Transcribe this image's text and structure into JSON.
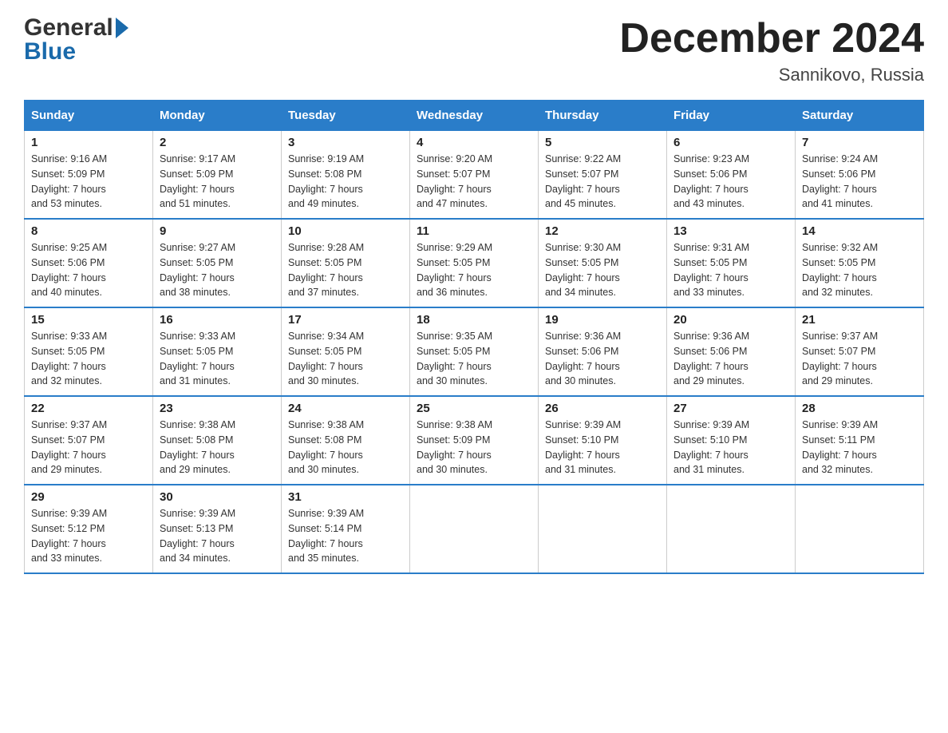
{
  "header": {
    "logo_line1": "General",
    "logo_line2": "Blue",
    "month_title": "December 2024",
    "location": "Sannikovo, Russia"
  },
  "days_of_week": [
    "Sunday",
    "Monday",
    "Tuesday",
    "Wednesday",
    "Thursday",
    "Friday",
    "Saturday"
  ],
  "weeks": [
    [
      {
        "day": "1",
        "sunrise": "9:16 AM",
        "sunset": "5:09 PM",
        "daylight_hours": "7",
        "daylight_mins": "53"
      },
      {
        "day": "2",
        "sunrise": "9:17 AM",
        "sunset": "5:09 PM",
        "daylight_hours": "7",
        "daylight_mins": "51"
      },
      {
        "day": "3",
        "sunrise": "9:19 AM",
        "sunset": "5:08 PM",
        "daylight_hours": "7",
        "daylight_mins": "49"
      },
      {
        "day": "4",
        "sunrise": "9:20 AM",
        "sunset": "5:07 PM",
        "daylight_hours": "7",
        "daylight_mins": "47"
      },
      {
        "day": "5",
        "sunrise": "9:22 AM",
        "sunset": "5:07 PM",
        "daylight_hours": "7",
        "daylight_mins": "45"
      },
      {
        "day": "6",
        "sunrise": "9:23 AM",
        "sunset": "5:06 PM",
        "daylight_hours": "7",
        "daylight_mins": "43"
      },
      {
        "day": "7",
        "sunrise": "9:24 AM",
        "sunset": "5:06 PM",
        "daylight_hours": "7",
        "daylight_mins": "41"
      }
    ],
    [
      {
        "day": "8",
        "sunrise": "9:25 AM",
        "sunset": "5:06 PM",
        "daylight_hours": "7",
        "daylight_mins": "40"
      },
      {
        "day": "9",
        "sunrise": "9:27 AM",
        "sunset": "5:05 PM",
        "daylight_hours": "7",
        "daylight_mins": "38"
      },
      {
        "day": "10",
        "sunrise": "9:28 AM",
        "sunset": "5:05 PM",
        "daylight_hours": "7",
        "daylight_mins": "37"
      },
      {
        "day": "11",
        "sunrise": "9:29 AM",
        "sunset": "5:05 PM",
        "daylight_hours": "7",
        "daylight_mins": "36"
      },
      {
        "day": "12",
        "sunrise": "9:30 AM",
        "sunset": "5:05 PM",
        "daylight_hours": "7",
        "daylight_mins": "34"
      },
      {
        "day": "13",
        "sunrise": "9:31 AM",
        "sunset": "5:05 PM",
        "daylight_hours": "7",
        "daylight_mins": "33"
      },
      {
        "day": "14",
        "sunrise": "9:32 AM",
        "sunset": "5:05 PM",
        "daylight_hours": "7",
        "daylight_mins": "32"
      }
    ],
    [
      {
        "day": "15",
        "sunrise": "9:33 AM",
        "sunset": "5:05 PM",
        "daylight_hours": "7",
        "daylight_mins": "32"
      },
      {
        "day": "16",
        "sunrise": "9:33 AM",
        "sunset": "5:05 PM",
        "daylight_hours": "7",
        "daylight_mins": "31"
      },
      {
        "day": "17",
        "sunrise": "9:34 AM",
        "sunset": "5:05 PM",
        "daylight_hours": "7",
        "daylight_mins": "30"
      },
      {
        "day": "18",
        "sunrise": "9:35 AM",
        "sunset": "5:05 PM",
        "daylight_hours": "7",
        "daylight_mins": "30"
      },
      {
        "day": "19",
        "sunrise": "9:36 AM",
        "sunset": "5:06 PM",
        "daylight_hours": "7",
        "daylight_mins": "30"
      },
      {
        "day": "20",
        "sunrise": "9:36 AM",
        "sunset": "5:06 PM",
        "daylight_hours": "7",
        "daylight_mins": "29"
      },
      {
        "day": "21",
        "sunrise": "9:37 AM",
        "sunset": "5:07 PM",
        "daylight_hours": "7",
        "daylight_mins": "29"
      }
    ],
    [
      {
        "day": "22",
        "sunrise": "9:37 AM",
        "sunset": "5:07 PM",
        "daylight_hours": "7",
        "daylight_mins": "29"
      },
      {
        "day": "23",
        "sunrise": "9:38 AM",
        "sunset": "5:08 PM",
        "daylight_hours": "7",
        "daylight_mins": "29"
      },
      {
        "day": "24",
        "sunrise": "9:38 AM",
        "sunset": "5:08 PM",
        "daylight_hours": "7",
        "daylight_mins": "30"
      },
      {
        "day": "25",
        "sunrise": "9:38 AM",
        "sunset": "5:09 PM",
        "daylight_hours": "7",
        "daylight_mins": "30"
      },
      {
        "day": "26",
        "sunrise": "9:39 AM",
        "sunset": "5:10 PM",
        "daylight_hours": "7",
        "daylight_mins": "31"
      },
      {
        "day": "27",
        "sunrise": "9:39 AM",
        "sunset": "5:10 PM",
        "daylight_hours": "7",
        "daylight_mins": "31"
      },
      {
        "day": "28",
        "sunrise": "9:39 AM",
        "sunset": "5:11 PM",
        "daylight_hours": "7",
        "daylight_mins": "32"
      }
    ],
    [
      {
        "day": "29",
        "sunrise": "9:39 AM",
        "sunset": "5:12 PM",
        "daylight_hours": "7",
        "daylight_mins": "33"
      },
      {
        "day": "30",
        "sunrise": "9:39 AM",
        "sunset": "5:13 PM",
        "daylight_hours": "7",
        "daylight_mins": "34"
      },
      {
        "day": "31",
        "sunrise": "9:39 AM",
        "sunset": "5:14 PM",
        "daylight_hours": "7",
        "daylight_mins": "35"
      },
      null,
      null,
      null,
      null
    ]
  ],
  "labels": {
    "sunrise": "Sunrise:",
    "sunset": "Sunset:",
    "daylight": "Daylight:",
    "hours": "hours",
    "and": "and",
    "minutes": "minutes."
  }
}
